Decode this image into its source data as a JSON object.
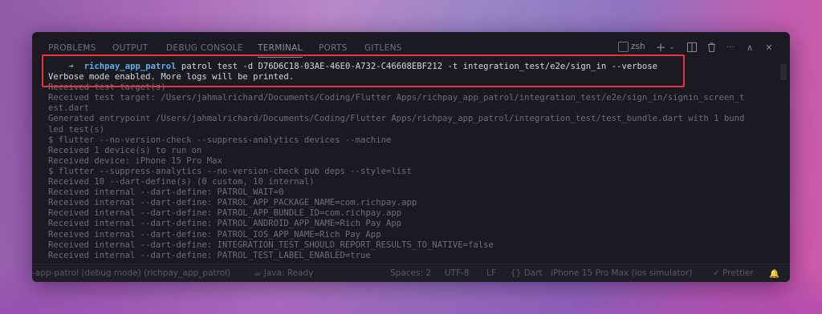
{
  "panel": {
    "tabs": [
      "PROBLEMS",
      "OUTPUT",
      "DEBUG CONSOLE",
      "TERMINAL",
      "PORTS",
      "GITLENS"
    ],
    "active_tab": "TERMINAL",
    "shell_name": "zsh",
    "controls": {
      "add": "+",
      "dropdown": "⌄",
      "split": "⊞",
      "trash": "🗑",
      "more": "···",
      "maximize": "∧",
      "close": "✕"
    }
  },
  "terminal": {
    "prompt_symbol": "➜",
    "prompt_dir": "richpay_app_patrol",
    "command": "patrol test -d D76D6C18-03AE-46E0-A732-C46608EBF212 -t integration_test/e2e/sign_in --verbose",
    "lines": [
      "Verbose mode enabled. More logs will be printed.",
      "Received test target(s)",
      "Received test target: /Users/jahmalrichard/Documents/Coding/Flutter Apps/richpay_app_patrol/integration_test/e2e/sign_in/signin_screen_t",
      "est.dart",
      "Generated entrypoint /Users/jahmalrichard/Documents/Coding/Flutter Apps/richpay_app_patrol/integration_test/test_bundle.dart with 1 bund",
      "led test(s)",
      "$ flutter --no-version-check --suppress-analytics devices --machine",
      "Received 1 device(s) to run on",
      "Received device: iPhone 15 Pro Max",
      "$ flutter --suppress-analytics --no-version-check pub deps --style=list",
      "Received 10 --dart-define(s) (0 custom, 10 internal)",
      "Received internal --dart-define: PATROL_WAIT=0",
      "Received internal --dart-define: PATROL_APP_PACKAGE_NAME=com.richpay.app",
      "Received internal --dart-define: PATROL_APP_BUNDLE_ID=com.richpay.app",
      "Received internal --dart-define: PATROL_ANDROID_APP_NAME=Rich Pay App",
      "Received internal --dart-define: PATROL_IOS_APP_NAME=Rich Pay App",
      "Received internal --dart-define: INTEGRATION_TEST_SHOULD_REPORT_RESULTS_TO_NATIVE=false",
      "Received internal --dart-define: PATROL_TEST_LABEL_ENABLED=true"
    ]
  },
  "status_bar": {
    "left": "-app-patrol (debug mode) (richpay_app_patrol)",
    "java": "Java: Ready",
    "spaces": "Spaces: 2",
    "encoding": "UTF-8",
    "eol": "LF",
    "language": "Dart",
    "device": "iPhone 15 Pro Max (ios simulator)",
    "formatter": "Prettier"
  },
  "colors": {
    "highlight_box": "#e8343a",
    "prompt_dir": "#61afef",
    "terminal_bg": "#1a1b22"
  }
}
